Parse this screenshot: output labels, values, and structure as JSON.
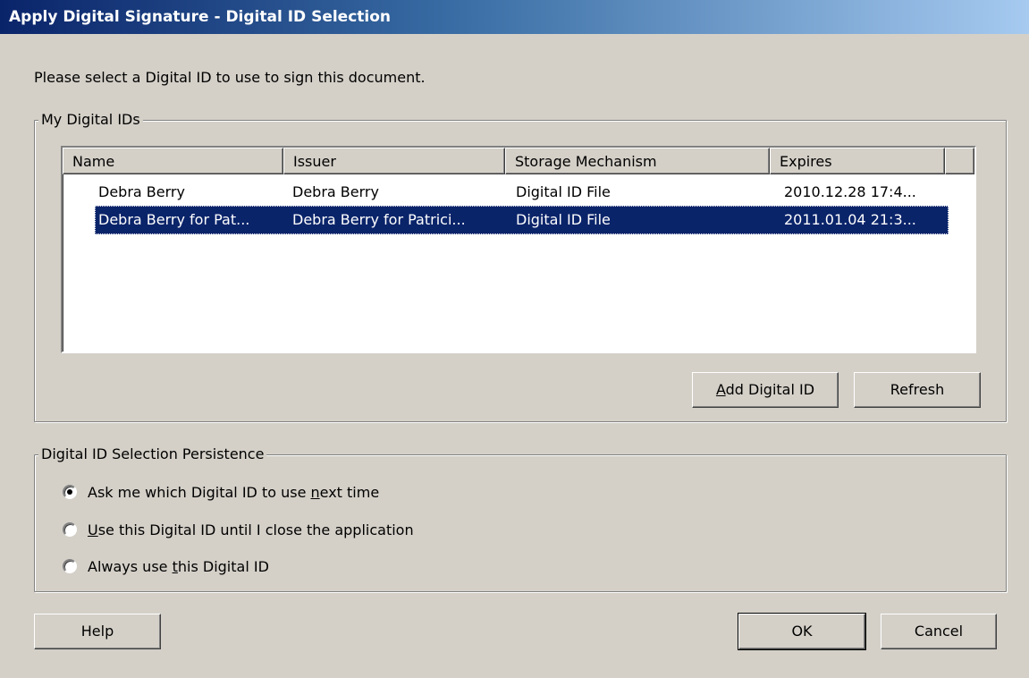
{
  "window": {
    "title": "Apply Digital Signature - Digital ID Selection"
  },
  "prompt": "Please select a Digital ID to use to sign this document.",
  "my_ids": {
    "group_title": "My Digital IDs",
    "columns": [
      "Name",
      "Issuer",
      "Storage Mechanism",
      "Expires"
    ],
    "rows": [
      {
        "name": "Debra Berry",
        "issuer": "Debra Berry",
        "storage": "Digital ID File",
        "expires": "2010.12.28 17:4..."
      },
      {
        "name": "Debra Berry for Pat...",
        "issuer": "Debra Berry for Patrici...",
        "storage": "Digital ID File",
        "expires": "2011.01.04 21:3..."
      }
    ],
    "selected_row": 1,
    "add_button_prefix": "A",
    "add_button_rest": "dd Digital ID",
    "refresh_button": "Refresh"
  },
  "persistence": {
    "group_title": "Digital ID Selection Persistence",
    "options": [
      {
        "pre": "Ask me which Digital ID to use ",
        "ul": "n",
        "post": "ext time",
        "checked": true
      },
      {
        "pre": "",
        "ul": "U",
        "post": "se this Digital ID until I close the application",
        "checked": false
      },
      {
        "pre": "Always use ",
        "ul": "t",
        "post": "his Digital ID",
        "checked": false
      }
    ]
  },
  "buttons": {
    "help": "Help",
    "ok": "OK",
    "cancel": "Cancel"
  },
  "colors": {
    "selection": "#0a246a",
    "dialog_bg": "#d4d0c8"
  }
}
